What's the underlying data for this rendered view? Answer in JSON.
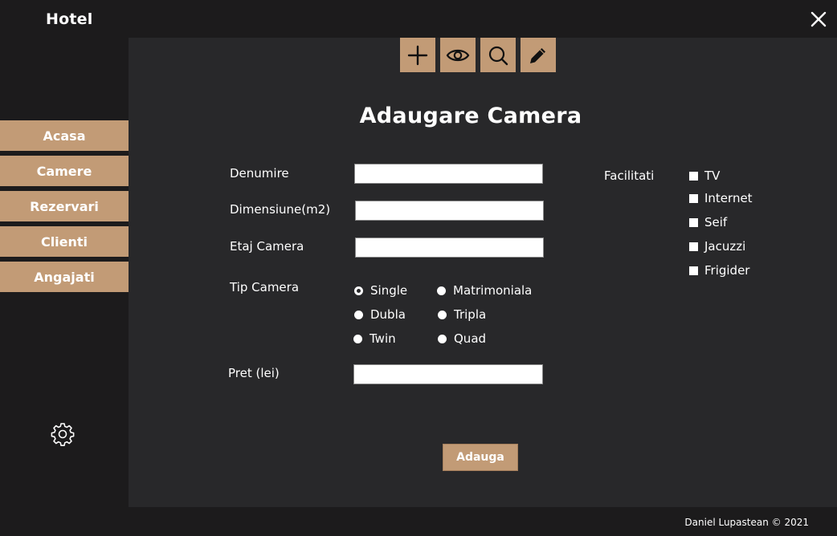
{
  "app": {
    "title": "Hotel"
  },
  "sidebar": {
    "items": [
      {
        "label": "Acasa"
      },
      {
        "label": "Camere"
      },
      {
        "label": "Rezervari"
      },
      {
        "label": "Clienti"
      },
      {
        "label": "Angajati"
      }
    ]
  },
  "toolbar": {
    "icons": [
      "plus-icon",
      "eye-icon",
      "search-icon",
      "pencil-icon"
    ]
  },
  "form": {
    "title": "Adaugare Camera",
    "denumire": {
      "label": "Denumire",
      "value": ""
    },
    "dimensiune": {
      "label": "Dimensiune(m2)",
      "value": ""
    },
    "etaj": {
      "label": "Etaj Camera",
      "value": ""
    },
    "tip": {
      "label": "Tip Camera",
      "options": [
        "Single",
        "Matrimoniala",
        "Dubla",
        "Tripla",
        "Twin",
        "Quad"
      ],
      "selected": "Single"
    },
    "pret": {
      "label": "Pret (lei)",
      "value": ""
    },
    "facilitati": {
      "label": "Facilitati",
      "options": [
        "TV",
        "Internet",
        "Seif",
        "Jacuzzi",
        "Frigider"
      ]
    },
    "submit_label": "Adauga"
  },
  "footer": {
    "text": "Daniel Lupastean © 2021"
  },
  "colors": {
    "accent": "#c29b76",
    "background": "#1c1b1c",
    "panel": "#28282a"
  }
}
